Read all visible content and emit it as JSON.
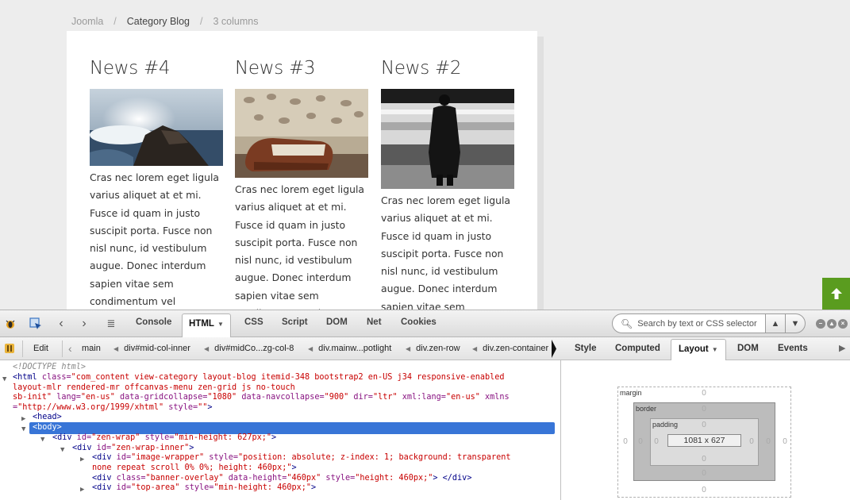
{
  "breadcrumb": {
    "items": [
      "Joomla",
      "Category Blog",
      "3 columns"
    ],
    "sep": "/"
  },
  "articles": [
    {
      "title": "News #4",
      "image": "waves-crashing-on-rocks",
      "text": "Cras nec lorem eget ligula varius aliquet at et mi. Fusce id quam in justo suscipit porta. Fusce non nisl nunc, id vestibulum augue. Donec interdum sapien vitae sem condimentum vel adipiscing leo consequat. In quis nisi"
    },
    {
      "title": "News #3",
      "image": "wallet-on-table",
      "text": "Cras nec lorem eget ligula varius aliquet at et mi. Fusce id quam in justo suscipit porta. Fusce non nisl nunc, id vestibulum augue. Donec interdum sapien vitae sem condimentum vel adipiscing leo consequat. In quis nisi"
    },
    {
      "title": "News #2",
      "image": "man-at-train-platform",
      "text": "Cras nec lorem eget ligula varius aliquet at et mi. Fusce id quam in justo suscipit porta. Fusce non nisl nunc, id vestibulum augue. Donec interdum sapien vitae sem condimentum vel adipiscing leo consequat."
    }
  ],
  "scroll_top_icon": "arrow-up-icon",
  "devtools": {
    "tabs": [
      "Console",
      "HTML",
      "CSS",
      "Script",
      "DOM",
      "Net",
      "Cookies"
    ],
    "active_tab": "HTML",
    "search_placeholder": "Search by text or CSS selector",
    "edit_label": "Edit",
    "crumbs": [
      "main",
      "div#mid-col-inner",
      "div#midCo...zg-col-8",
      "div.mainw...potlight",
      "div.zen-row",
      "div.zen-container"
    ],
    "side_tabs": [
      "Style",
      "Computed",
      "Layout",
      "DOM",
      "Events"
    ],
    "active_side_tab": "Layout",
    "tree": {
      "doctype": "<!DOCTYPE html>",
      "html_open": "<html",
      "html_class_attr": "class=",
      "html_class_val": "\"com_content view-category layout-blog itemid-348 bootstrap2 en-US j34 responsive-enabled",
      "html_class_val2": "layout-mlr rendered-mr offcanvas-menu zen-grid js no-touch",
      "html_class_val3": "sb-init\"",
      "html_rest_a": " lang=",
      "html_lang": "\"en-us\"",
      "html_rest_b": " data-gridcollapse=",
      "html_grid": "\"1080\"",
      "html_rest_c": " data-navcollapse=",
      "html_nav": "\"900\"",
      "html_rest_d": " dir=",
      "html_dir": "\"ltr\"",
      "html_rest_e": " xml:lang=",
      "html_xmllang": "\"en-us\"",
      "html_rest_f": " xmlns",
      "html_rest_g": "=",
      "html_xmlns": "\"http://www.w3.org/1999/xhtml\"",
      "html_rest_h": " style=",
      "html_style": "\"\"",
      "html_close": ">",
      "head": "<head>",
      "body": "<body>",
      "zen_wrap_a": "<div",
      "zen_wrap_b": " id=",
      "zen_wrap_id": "\"zen-wrap\"",
      "zen_wrap_c": " style=",
      "zen_wrap_style": "\"min-height: 627px;\"",
      "zen_wrap_d": ">",
      "zen_inner_a": "<div",
      "zen_inner_b": " id=",
      "zen_inner_id": "\"zen-wrap-inner\"",
      "zen_inner_c": ">",
      "img_a": "<div",
      "img_b": " id=",
      "img_id": "\"image-wrapper\"",
      "img_c": " style=",
      "img_style": "\"position: absolute; z-index: 1; background: transparent",
      "img_style2": "none repeat scroll 0% 0%; height: 460px;\"",
      "img_d": ">",
      "banner_a": "<div",
      "banner_b": " class=",
      "banner_class": "\"banner-overlay\"",
      "banner_c": " data-height=",
      "banner_dh": "\"460px\"",
      "banner_d": " style=",
      "banner_style": "\"height: 460px;\"",
      "banner_e": ">",
      "banner_close": " </div>",
      "top_a": "<div",
      "top_b": " id=",
      "top_id": "\"top-area\"",
      "top_c": " style=",
      "top_style": "\"min-height: 460px;\"",
      "top_d": ">"
    },
    "layout": {
      "margin_label": "margin",
      "border_label": "border",
      "padding_label": "padding",
      "size": "1081 x 627",
      "margin": {
        "top": "0",
        "right": "0",
        "bottom": "0",
        "left": "0"
      },
      "border": {
        "top": "0",
        "right": "0",
        "bottom": "0",
        "left": "0"
      },
      "padding": {
        "top": "0",
        "right": "0",
        "bottom": "0",
        "left": "0"
      }
    }
  },
  "colors": {
    "accent_green": "#5a9c1f",
    "selection_blue": "#3875d7",
    "tag": "#000088",
    "attr": "#881280",
    "value": "#c80000"
  }
}
